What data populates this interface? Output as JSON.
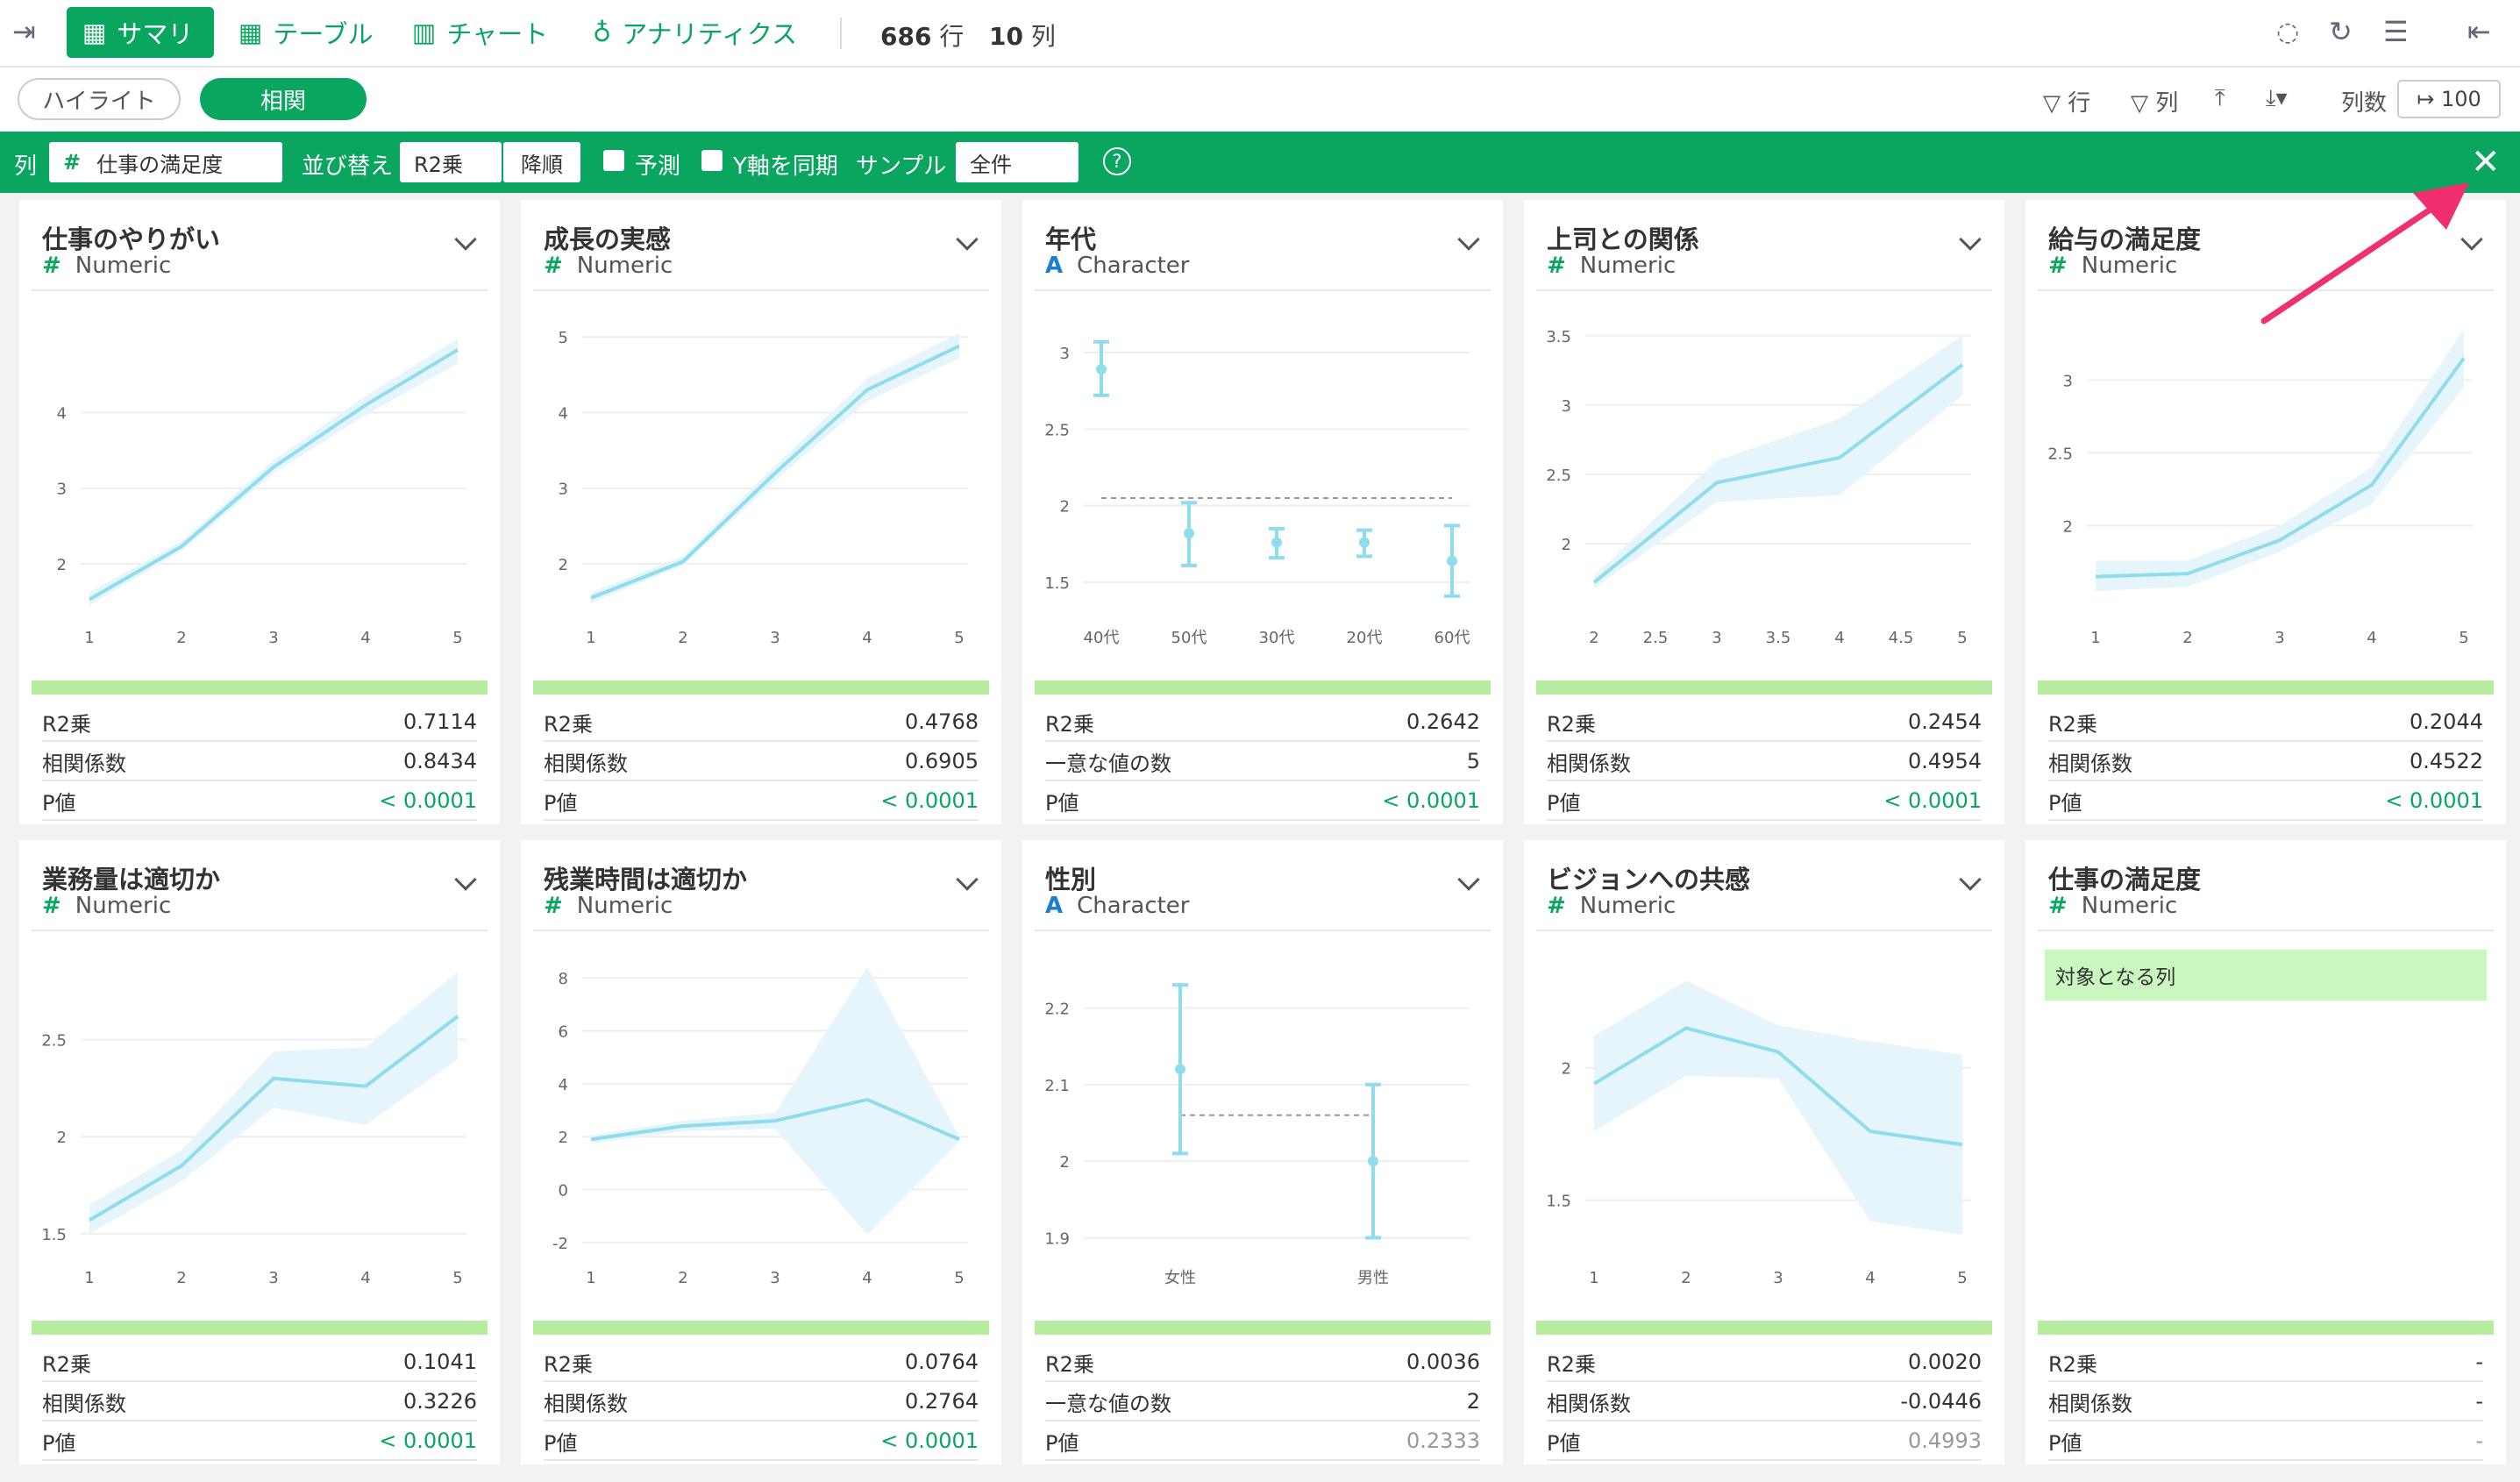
{
  "toolbar": {
    "summary": "サマリ",
    "table": "テーブル",
    "chart": "チャート",
    "analytics": "アナリティクス",
    "rows": "686",
    "rows_unit": "行",
    "cols": "10",
    "cols_unit": "列"
  },
  "subbar": {
    "highlight": "ハイライト",
    "correlation": "相関",
    "row_filter": "行",
    "col_filter": "列",
    "col_count_label": "列数",
    "col_count_value": "100"
  },
  "corrbar": {
    "col_label": "列",
    "col_value": "仕事の満足度",
    "sort_label": "並び替え",
    "sort_value": "R2乗",
    "sort_order": "降順",
    "predict": "予測",
    "sync_y": "Y軸を同期",
    "sample_label": "サンプル",
    "sample_value": "全件",
    "help": "?"
  },
  "colors": {
    "accent": "#0aa55f",
    "line": "#8fdcec",
    "band": "#e6f5fc",
    "bar": "#b6ec9e",
    "arrow": "#f0306e"
  },
  "cards": [
    {
      "title": "仕事のやりがい",
      "type": "Numeric",
      "sym": "#",
      "kind": "line",
      "chart": {
        "x": [
          1,
          2,
          3,
          4,
          5
        ],
        "y": [
          1.53,
          2.23,
          3.28,
          4.1,
          4.83
        ],
        "lo": [
          1.45,
          2.17,
          3.2,
          3.97,
          4.65
        ],
        "hi": [
          1.62,
          2.3,
          3.37,
          4.22,
          4.98
        ],
        "ymin": 1.35,
        "ymax": 5.2,
        "yticks": [
          2,
          3,
          4
        ],
        "xticks": [
          "1",
          "2",
          "3",
          "4",
          "5"
        ]
      },
      "stats": [
        {
          "label": "R2乗",
          "value": "0.7114",
          "style": ""
        },
        {
          "label": "相関係数",
          "value": "0.8434",
          "style": ""
        },
        {
          "label": "P値",
          "value": "< 0.0001",
          "style": "green"
        }
      ]
    },
    {
      "title": "成長の実感",
      "type": "Numeric",
      "sym": "#",
      "kind": "line",
      "chart": {
        "x": [
          1,
          2,
          3,
          4,
          5
        ],
        "y": [
          1.55,
          2.03,
          3.2,
          4.3,
          4.88
        ],
        "lo": [
          1.48,
          1.98,
          3.1,
          4.15,
          4.72
        ],
        "hi": [
          1.62,
          2.1,
          3.3,
          4.45,
          5.05
        ],
        "ymin": 1.35,
        "ymax": 5.2,
        "yticks": [
          2,
          3,
          4,
          5
        ],
        "xticks": [
          "1",
          "2",
          "3",
          "4",
          "5"
        ]
      },
      "stats": [
        {
          "label": "R2乗",
          "value": "0.4768",
          "style": ""
        },
        {
          "label": "相関係数",
          "value": "0.6905",
          "style": ""
        },
        {
          "label": "P値",
          "value": "< 0.0001",
          "style": "green"
        }
      ]
    },
    {
      "title": "年代",
      "type": "Character",
      "sym": "A",
      "kind": "errbar",
      "chart": {
        "cats": [
          "40代",
          "50代",
          "30代",
          "20代",
          "60代"
        ],
        "y": [
          2.89,
          1.82,
          1.76,
          1.76,
          1.64
        ],
        "lo": [
          2.72,
          1.61,
          1.66,
          1.67,
          1.41
        ],
        "hi": [
          3.07,
          2.02,
          1.85,
          1.84,
          1.87
        ],
        "ref": 2.05,
        "ymin": 1.3,
        "ymax": 3.2,
        "yticks": [
          1.5,
          2,
          2.5,
          3
        ]
      },
      "stats": [
        {
          "label": "R2乗",
          "value": "0.2642",
          "style": ""
        },
        {
          "label": "一意な値の数",
          "value": "5",
          "style": ""
        },
        {
          "label": "P値",
          "value": "< 0.0001",
          "style": "green"
        }
      ]
    },
    {
      "title": "上司との関係",
      "type": "Numeric",
      "sym": "#",
      "kind": "line",
      "chart": {
        "x": [
          2,
          3,
          4,
          5
        ],
        "y": [
          1.72,
          2.44,
          2.62,
          3.29
        ],
        "lo": [
          1.68,
          2.3,
          2.35,
          3.07
        ],
        "hi": [
          1.77,
          2.6,
          2.9,
          3.5
        ],
        "ymin": 1.5,
        "ymax": 3.6,
        "yticks": [
          2,
          2.5,
          3,
          3.5
        ],
        "xticks": [
          "2",
          "2.5",
          "3",
          "3.5",
          "4",
          "4.5",
          "5"
        ],
        "xvals": [
          2,
          2.5,
          3,
          3.5,
          4,
          4.5,
          5
        ]
      },
      "stats": [
        {
          "label": "R2乗",
          "value": "0.2454",
          "style": ""
        },
        {
          "label": "相関係数",
          "value": "0.4954",
          "style": ""
        },
        {
          "label": "P値",
          "value": "< 0.0001",
          "style": "green"
        }
      ]
    },
    {
      "title": "給与の満足度",
      "type": "Numeric",
      "sym": "#",
      "kind": "line",
      "chart": {
        "x": [
          1,
          2,
          3,
          4,
          5
        ],
        "y": [
          1.65,
          1.67,
          1.9,
          2.28,
          3.15
        ],
        "lo": [
          1.55,
          1.58,
          1.82,
          2.15,
          2.95
        ],
        "hi": [
          1.76,
          1.76,
          2.0,
          2.4,
          3.35
        ],
        "ymin": 1.4,
        "ymax": 3.4,
        "yticks": [
          2,
          2.5,
          3
        ],
        "xticks": [
          "1",
          "2",
          "3",
          "4",
          "5"
        ]
      },
      "stats": [
        {
          "label": "R2乗",
          "value": "0.2044",
          "style": ""
        },
        {
          "label": "相関係数",
          "value": "0.4522",
          "style": ""
        },
        {
          "label": "P値",
          "value": "< 0.0001",
          "style": "green"
        }
      ]
    },
    {
      "title": "業務量は適切か",
      "type": "Numeric",
      "sym": "#",
      "kind": "line",
      "chart": {
        "x": [
          1,
          2,
          3,
          4,
          5
        ],
        "y": [
          1.57,
          1.85,
          2.3,
          2.26,
          2.62
        ],
        "lo": [
          1.5,
          1.77,
          2.15,
          2.06,
          2.4
        ],
        "hi": [
          1.65,
          1.93,
          2.44,
          2.46,
          2.85
        ],
        "ymin": 1.4,
        "ymax": 2.9,
        "yticks": [
          1.5,
          2,
          2.5
        ],
        "xticks": [
          "1",
          "2",
          "3",
          "4",
          "5"
        ]
      },
      "stats": [
        {
          "label": "R2乗",
          "value": "0.1041",
          "style": ""
        },
        {
          "label": "相関係数",
          "value": "0.3226",
          "style": ""
        },
        {
          "label": "P値",
          "value": "< 0.0001",
          "style": "green"
        }
      ]
    },
    {
      "title": "残業時間は適切か",
      "type": "Numeric",
      "sym": "#",
      "kind": "line",
      "chart": {
        "x": [
          1,
          2,
          3,
          4,
          5
        ],
        "y": [
          1.9,
          2.4,
          2.6,
          3.4,
          1.9
        ],
        "lo": [
          1.75,
          2.2,
          2.3,
          -1.7,
          1.8
        ],
        "hi": [
          2.05,
          2.6,
          2.9,
          8.4,
          2.0
        ],
        "ymin": -2.4,
        "ymax": 8.6,
        "yticks": [
          -2,
          0,
          2,
          4,
          6,
          8
        ],
        "xticks": [
          "1",
          "2",
          "3",
          "4",
          "5"
        ]
      },
      "stats": [
        {
          "label": "R2乗",
          "value": "0.0764",
          "style": ""
        },
        {
          "label": "相関係数",
          "value": "0.2764",
          "style": ""
        },
        {
          "label": "P値",
          "value": "< 0.0001",
          "style": "green"
        }
      ]
    },
    {
      "title": "性別",
      "type": "Character",
      "sym": "A",
      "kind": "errbar",
      "chart": {
        "cats": [
          "女性",
          "男性"
        ],
        "y": [
          2.12,
          2.0
        ],
        "lo": [
          2.01,
          1.9
        ],
        "hi": [
          2.23,
          2.1
        ],
        "ref": 2.06,
        "ymin": 1.88,
        "ymax": 2.26,
        "yticks": [
          1.9,
          2,
          2.1,
          2.2
        ]
      },
      "stats": [
        {
          "label": "R2乗",
          "value": "0.0036",
          "style": ""
        },
        {
          "label": "一意な値の数",
          "value": "2",
          "style": ""
        },
        {
          "label": "P値",
          "value": "0.2333",
          "style": "gray"
        }
      ]
    },
    {
      "title": "ビジョンへの共感",
      "type": "Numeric",
      "sym": "#",
      "kind": "line",
      "chart": {
        "x": [
          1,
          2,
          3,
          4,
          5
        ],
        "y": [
          1.94,
          2.15,
          2.06,
          1.76,
          1.71
        ],
        "lo": [
          1.76,
          1.97,
          1.96,
          1.42,
          1.37
        ],
        "hi": [
          2.12,
          2.33,
          2.16,
          2.1,
          2.05
        ],
        "ymin": 1.3,
        "ymax": 2.4,
        "yticks": [
          1.5,
          2
        ],
        "xticks": [
          "1",
          "2",
          "3",
          "4",
          "5"
        ]
      },
      "stats": [
        {
          "label": "R2乗",
          "value": "0.0020",
          "style": ""
        },
        {
          "label": "相関係数",
          "value": "-0.0446",
          "style": ""
        },
        {
          "label": "P値",
          "value": "0.4993",
          "style": "gray"
        }
      ]
    },
    {
      "title": "仕事の満足度",
      "type": "Numeric",
      "sym": "#",
      "kind": "target",
      "target_label": "対象となる列",
      "stats": [
        {
          "label": "R2乗",
          "value": "-",
          "style": ""
        },
        {
          "label": "相関係数",
          "value": "-",
          "style": ""
        },
        {
          "label": "P値",
          "value": "-",
          "style": "gray"
        }
      ]
    }
  ]
}
